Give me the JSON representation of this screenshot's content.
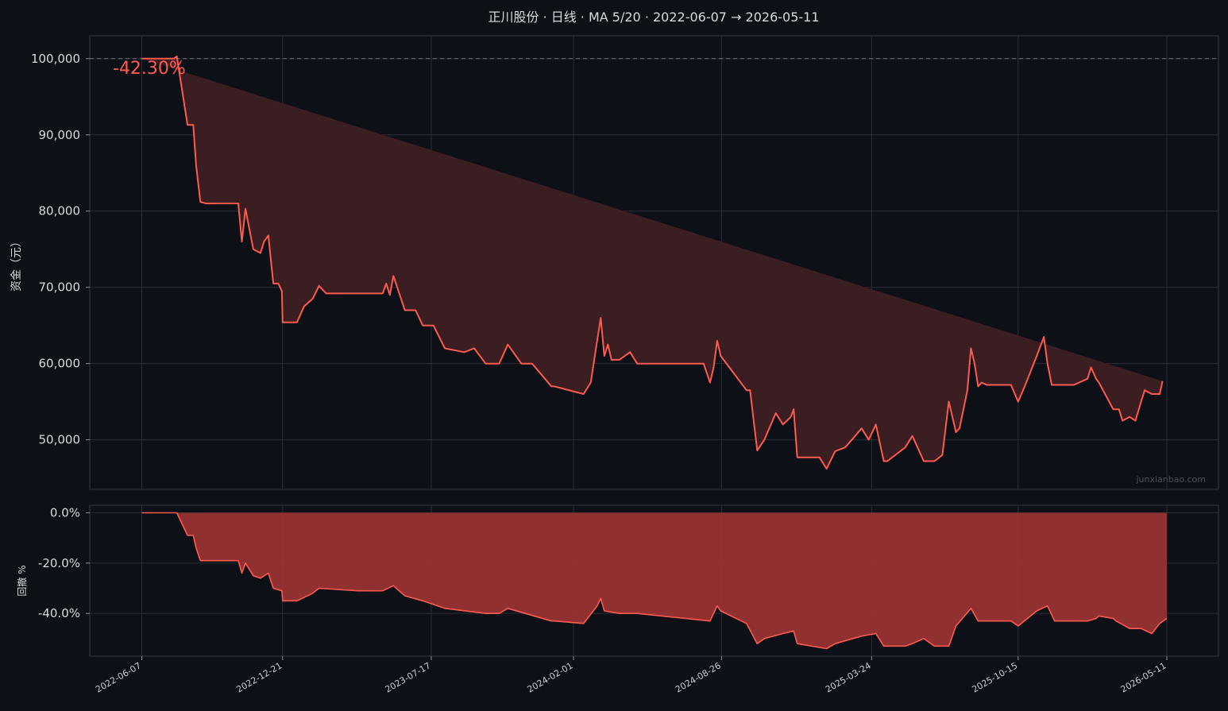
{
  "title": "正川股份 · 日线 · MA 5/20 · 2022-06-07 → 2026-05-11",
  "watermark": "junxianbao.com",
  "return_label": "-42.30%",
  "colors": {
    "background": "#0d1017",
    "line": "#ff5a4f",
    "equity_fill": "#3a1e22",
    "drawdown_fill": "#993333",
    "grid": "#2a2e38",
    "baseline": "#6b7080"
  },
  "chart_data": [
    {
      "type": "line",
      "name": "equity",
      "ylabel": "资金（元）",
      "ylim": [
        43500,
        103000
      ],
      "yticks": [
        50000,
        60000,
        70000,
        80000,
        90000,
        100000
      ],
      "ytick_labels": [
        "50,000",
        "60,000",
        "70,000",
        "80,000",
        "90,000",
        "100,000"
      ],
      "baseline": 100000,
      "fill_to": 100000,
      "grid": true,
      "x": [
        "2022-06-07",
        "2022-07-01",
        "2022-07-22",
        "2022-07-26",
        "2022-08-10",
        "2022-08-18",
        "2022-08-22",
        "2022-08-28",
        "2022-09-05",
        "2022-10-20",
        "2022-10-25",
        "2022-10-30",
        "2022-11-10",
        "2022-11-20",
        "2022-11-25",
        "2022-12-01",
        "2022-12-08",
        "2022-12-15",
        "2022-12-20",
        "2022-12-21",
        "2023-01-10",
        "2023-01-20",
        "2023-02-01",
        "2023-02-10",
        "2023-02-20",
        "2023-04-05",
        "2023-05-10",
        "2023-05-15",
        "2023-05-20",
        "2023-05-25",
        "2023-06-10",
        "2023-06-25",
        "2023-07-05",
        "2023-07-20",
        "2023-08-05",
        "2023-09-01",
        "2023-09-15",
        "2023-10-01",
        "2023-10-20",
        "2023-11-01",
        "2023-11-20",
        "2023-12-05",
        "2024-01-01",
        "2024-01-05",
        "2024-02-15",
        "2024-02-25",
        "2024-03-05",
        "2024-03-10",
        "2024-03-15",
        "2024-03-20",
        "2024-03-25",
        "2024-04-05",
        "2024-04-20",
        "2024-04-30",
        "2024-05-10",
        "2024-05-20",
        "2024-06-01",
        "2024-07-01",
        "2024-08-01",
        "2024-08-10",
        "2024-08-15",
        "2024-08-20",
        "2024-08-25",
        "2024-09-30",
        "2024-10-05",
        "2024-10-15",
        "2024-10-25",
        "2024-11-10",
        "2024-11-20",
        "2024-12-01",
        "2024-12-05",
        "2024-12-10",
        "2025-01-10",
        "2025-01-20",
        "2025-02-01",
        "2025-02-15",
        "2025-03-01",
        "2025-03-10",
        "2025-03-20",
        "2025-03-30",
        "2025-04-10",
        "2025-04-15",
        "2025-05-10",
        "2025-05-20",
        "2025-06-05",
        "2025-06-20",
        "2025-07-01",
        "2025-07-10",
        "2025-07-20",
        "2025-07-25",
        "2025-08-05",
        "2025-08-10",
        "2025-08-15",
        "2025-08-20",
        "2025-08-25",
        "2025-09-01",
        "2025-09-05",
        "2025-10-05",
        "2025-10-15",
        "2025-10-25",
        "2025-11-10",
        "2025-11-20",
        "2025-11-25",
        "2025-12-01",
        "2025-12-05",
        "2026-01-01",
        "2026-01-20",
        "2026-01-25",
        "2026-02-01",
        "2026-02-05",
        "2026-02-25",
        "2026-03-01",
        "2026-03-05",
        "2026-03-10",
        "2026-03-20",
        "2026-03-28",
        "2026-04-05",
        "2026-04-10",
        "2026-04-20",
        "2026-05-01",
        "2026-05-05",
        "2026-05-11"
      ],
      "y": [
        100000,
        100000,
        100000,
        100300,
        91300,
        91300,
        86000,
        81200,
        81000,
        81000,
        76000,
        80300,
        75000,
        74500,
        76000,
        76800,
        70500,
        70500,
        69500,
        65400,
        65400,
        67500,
        68500,
        70200,
        69200,
        69200,
        69200,
        70500,
        69000,
        71500,
        67000,
        67000,
        65000,
        65000,
        62000,
        61500,
        62000,
        60000,
        60000,
        62500,
        60000,
        60000,
        57000,
        57000,
        56000,
        57500,
        63000,
        66000,
        61000,
        62500,
        60500,
        60500,
        61500,
        60000,
        60000,
        60000,
        60000,
        60000,
        60000,
        57500,
        59500,
        63000,
        61000,
        56500,
        56500,
        48600,
        50000,
        53500,
        52000,
        53000,
        54000,
        47700,
        47700,
        46200,
        48500,
        49000,
        50500,
        51500,
        50000,
        52000,
        47200,
        47200,
        49000,
        50500,
        47200,
        47200,
        48000,
        55000,
        51000,
        51500,
        56500,
        62000,
        60000,
        57000,
        57500,
        57200,
        57200,
        57200,
        55000,
        57200,
        61000,
        63500,
        60000,
        57200,
        57200,
        57200,
        58000,
        59500,
        58000,
        57500,
        54000,
        54000,
        54000,
        52500,
        53000,
        52500,
        55000,
        56500,
        56000,
        56000,
        57700
      ]
    },
    {
      "type": "area",
      "name": "drawdown",
      "ylabel": "回撤 %",
      "ylim": [
        -57,
        3
      ],
      "yticks": [
        0,
        -20,
        -40
      ],
      "ytick_labels": [
        "0.0%",
        "-20.0%",
        "-40.0%"
      ],
      "grid": true,
      "x": [
        "2022-06-07",
        "2022-07-22",
        "2022-07-26",
        "2022-08-10",
        "2022-08-18",
        "2022-08-22",
        "2022-08-28",
        "2022-09-05",
        "2022-10-20",
        "2022-10-25",
        "2022-10-30",
        "2022-11-10",
        "2022-11-20",
        "2022-12-01",
        "2022-12-08",
        "2022-12-20",
        "2022-12-21",
        "2023-01-10",
        "2023-02-01",
        "2023-02-10",
        "2023-04-05",
        "2023-05-10",
        "2023-05-25",
        "2023-06-10",
        "2023-07-05",
        "2023-08-05",
        "2023-10-01",
        "2023-10-20",
        "2023-11-01",
        "2024-01-01",
        "2024-01-05",
        "2024-02-15",
        "2024-03-05",
        "2024-03-10",
        "2024-03-15",
        "2024-04-05",
        "2024-04-30",
        "2024-08-10",
        "2024-08-20",
        "2024-08-25",
        "2024-09-30",
        "2024-10-15",
        "2024-10-25",
        "2024-11-20",
        "2024-12-05",
        "2024-12-10",
        "2025-01-20",
        "2025-02-01",
        "2025-03-10",
        "2025-03-30",
        "2025-04-10",
        "2025-05-10",
        "2025-05-20",
        "2025-06-05",
        "2025-06-20",
        "2025-07-10",
        "2025-07-20",
        "2025-08-10",
        "2025-08-20",
        "2025-09-01",
        "2025-10-05",
        "2025-10-15",
        "2025-11-10",
        "2025-11-25",
        "2025-12-05",
        "2026-01-20",
        "2026-02-01",
        "2026-02-05",
        "2026-02-25",
        "2026-03-01",
        "2026-03-20",
        "2026-04-05",
        "2026-04-20",
        "2026-05-01",
        "2026-05-11"
      ],
      "y": [
        0,
        0,
        0,
        -9,
        -9,
        -14,
        -19,
        -19,
        -19,
        -24,
        -20,
        -25,
        -26,
        -24,
        -30,
        -31,
        -35,
        -35,
        -32,
        -30,
        -31,
        -31,
        -29,
        -33,
        -35,
        -38,
        -40,
        -40,
        -38,
        -43,
        -43,
        -44,
        -37,
        -34,
        -39,
        -40,
        -40,
        -43,
        -37,
        -39,
        -44,
        -52,
        -50,
        -48,
        -47,
        -52,
        -54,
        -52,
        -49,
        -48,
        -53,
        -53,
        -52,
        -50,
        -53,
        -53,
        -45,
        -38,
        -43,
        -43,
        -43,
        -45,
        -39,
        -37,
        -43,
        -43,
        -42,
        -41,
        -42,
        -43,
        -46,
        -46,
        -48,
        -44,
        -42
      ]
    }
  ],
  "x_axis": {
    "ticks": [
      "2022-06-07",
      "2022-12-21",
      "2023-07-17",
      "2024-02-01",
      "2024-08-26",
      "2025-03-24",
      "2025-10-15",
      "2026-05-11"
    ]
  }
}
